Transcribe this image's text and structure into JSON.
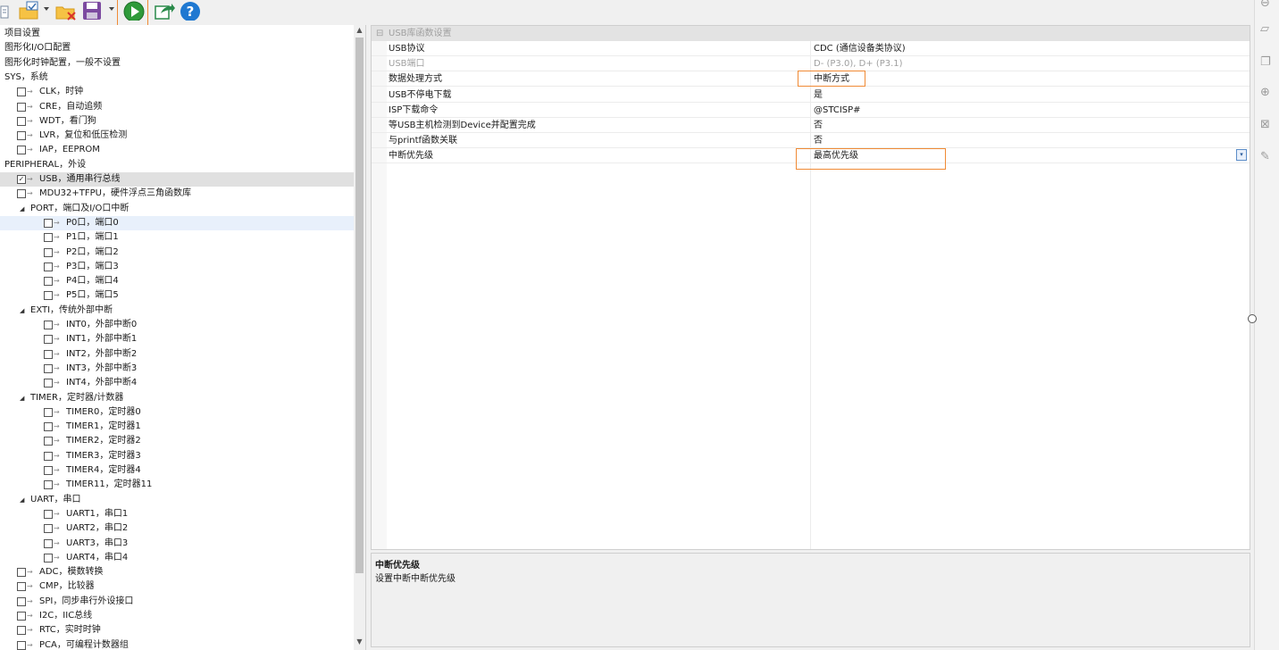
{
  "toolbar": {
    "buttons": [
      {
        "icon": "document-icon"
      },
      {
        "icon": "open-folder-icon"
      },
      {
        "icon": "dropdown-arrow-icon"
      },
      {
        "icon": "delete-folder-icon"
      },
      {
        "icon": "save-icon"
      },
      {
        "icon": "dropdown-arrow-icon"
      },
      {
        "icon": "run-icon",
        "highlighted": true
      },
      {
        "icon": "export-icon"
      },
      {
        "icon": "help-icon"
      }
    ],
    "accent": "#f08a35"
  },
  "tree": {
    "items": [
      {
        "label": "项目设置"
      },
      {
        "label": "图形化I/O口配置"
      },
      {
        "label": "图形化时钟配置，一般不设置"
      },
      {
        "label": "SYS，系统"
      },
      {
        "label": "CLK，时钟",
        "checked": false
      },
      {
        "label": "CRE，自动追频",
        "checked": false
      },
      {
        "label": "WDT，看门狗",
        "checked": false
      },
      {
        "label": "LVR，复位和低压检测",
        "checked": false
      },
      {
        "label": "IAP，EEPROM",
        "checked": false
      },
      {
        "label": "PERIPHERAL，外设"
      },
      {
        "label": "USB，通用串行总线",
        "checked": true,
        "selected": true
      },
      {
        "label": "MDU32+TFPU，硬件浮点三角函数库",
        "checked": false
      },
      {
        "label": "PORT，端口及I/O口中断",
        "expanded": true
      },
      {
        "label": "P0口，端口0",
        "checked": false,
        "hover": true
      },
      {
        "label": "P1口，端口1",
        "checked": false
      },
      {
        "label": "P2口，端口2",
        "checked": false
      },
      {
        "label": "P3口，端口3",
        "checked": false
      },
      {
        "label": "P4口，端口4",
        "checked": false
      },
      {
        "label": "P5口，端口5",
        "checked": false
      },
      {
        "label": "EXTI，传统外部中断",
        "expanded": true
      },
      {
        "label": "INT0，外部中断0",
        "checked": false
      },
      {
        "label": "INT1，外部中断1",
        "checked": false
      },
      {
        "label": "INT2，外部中断2",
        "checked": false
      },
      {
        "label": "INT3，外部中断3",
        "checked": false
      },
      {
        "label": "INT4，外部中断4",
        "checked": false
      },
      {
        "label": "TIMER，定时器/计数器",
        "expanded": true
      },
      {
        "label": "TIMER0，定时器0",
        "checked": false
      },
      {
        "label": "TIMER1，定时器1",
        "checked": false
      },
      {
        "label": "TIMER2，定时器2",
        "checked": false
      },
      {
        "label": "TIMER3，定时器3",
        "checked": false
      },
      {
        "label": "TIMER4，定时器4",
        "checked": false
      },
      {
        "label": "TIMER11，定时器11",
        "checked": false
      },
      {
        "label": "UART，串口",
        "expanded": true
      },
      {
        "label": "UART1，串口1",
        "checked": false
      },
      {
        "label": "UART2，串口2",
        "checked": false
      },
      {
        "label": "UART3，串口3",
        "checked": false
      },
      {
        "label": "UART4，串口4",
        "checked": false
      },
      {
        "label": "ADC，模数转换",
        "checked": false
      },
      {
        "label": "CMP，比较器",
        "checked": false
      },
      {
        "label": "SPI，同步串行外设接口",
        "checked": false
      },
      {
        "label": "I2C，IIC总线",
        "checked": false
      },
      {
        "label": "RTC，实时时钟",
        "checked": false
      },
      {
        "label": "PCA，可编程计数器组",
        "checked": false
      }
    ]
  },
  "grid": {
    "category": "USB库函数设置",
    "rows": [
      {
        "name": "USB协议",
        "value": "CDC (通信设备类协议)"
      },
      {
        "name": "USB端口",
        "value": "D- (P3.0), D+ (P3.1)",
        "disabled": true
      },
      {
        "name": "数据处理方式",
        "value": "中断方式",
        "highlighted": true
      },
      {
        "name": "USB不停电下载",
        "value": "是"
      },
      {
        "name": "ISP下载命令",
        "value": "@STCISP#"
      },
      {
        "name": "等USB主机检测到Device并配置完成",
        "value": "否"
      },
      {
        "name": "与printf函数关联",
        "value": "否"
      },
      {
        "name": "中断优先级",
        "value": "最高优先级",
        "highlighted": true,
        "selected": true
      }
    ]
  },
  "description": {
    "title": "中断优先级",
    "text": "设置中断中断优先级"
  }
}
